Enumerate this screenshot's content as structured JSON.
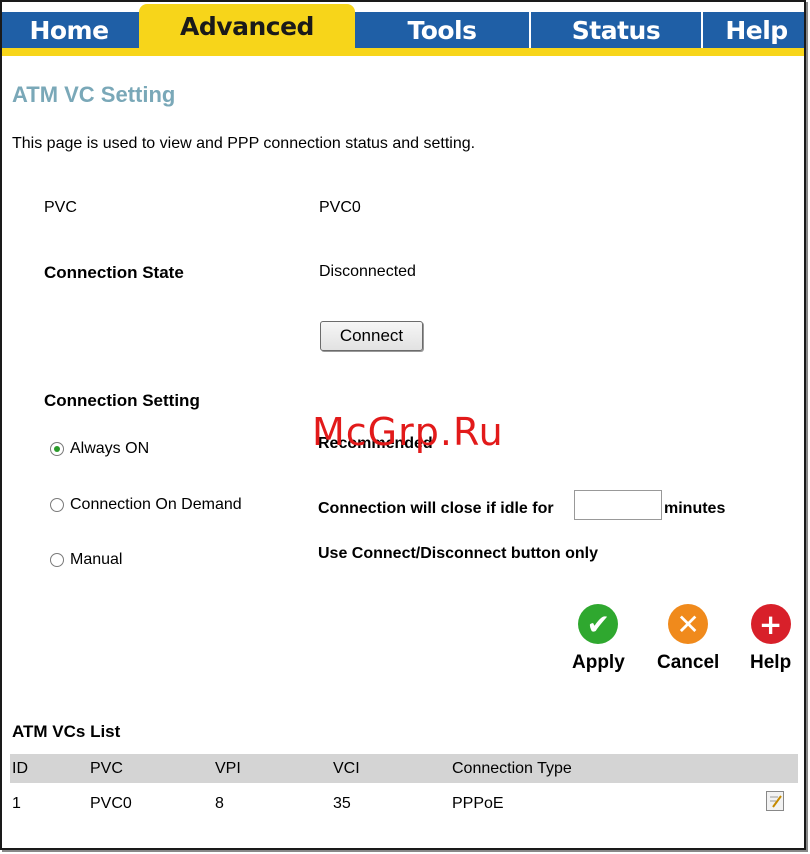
{
  "tabs": [
    {
      "label": "Home"
    },
    {
      "label": "Advanced"
    },
    {
      "label": "Tools"
    },
    {
      "label": "Status"
    },
    {
      "label": "Help"
    }
  ],
  "page": {
    "title": "ATM VC Setting",
    "description": "This page is used to view and PPP connection status and setting."
  },
  "fields": {
    "pvc_label": "PVC",
    "pvc_value": "PVC0",
    "state_label": "Connection State",
    "state_value": "Disconnected",
    "connect_button": "Connect",
    "setting_label": "Connection Setting"
  },
  "options": {
    "always_on": "Always ON",
    "always_on_note": "Recommended",
    "on_demand": "Connection On Demand",
    "on_demand_note": "Connection will close if idle for",
    "idle_value": "",
    "on_demand_unit": "minutes",
    "manual": "Manual",
    "manual_note": "Use Connect/Disconnect button only"
  },
  "actions": {
    "apply": "Apply",
    "cancel": "Cancel",
    "help": "Help"
  },
  "list": {
    "title": "ATM VCs List",
    "headers": [
      "ID",
      "PVC",
      "VPI",
      "VCI",
      "Connection Type"
    ],
    "rows": [
      [
        "1",
        "PVC0",
        "8",
        "35",
        "PPPoE"
      ]
    ]
  },
  "watermark": "McGrp.Ru",
  "colors": {
    "tab_blue": "#1f5fa6",
    "tab_yellow": "#f7d51a",
    "title_color": "#7aa8b8",
    "apply_green": "#2fa82f",
    "cancel_orange": "#f08a1c",
    "help_red": "#d8202a"
  }
}
